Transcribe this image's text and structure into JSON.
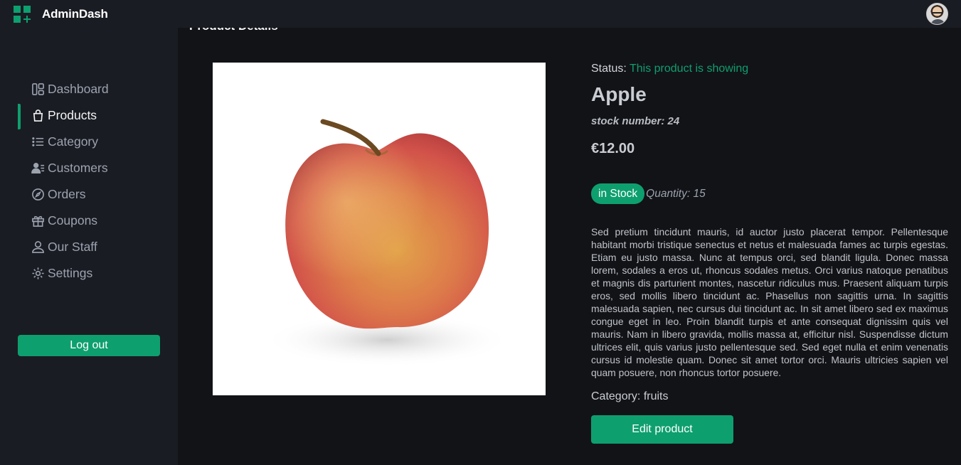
{
  "app": {
    "name": "AdminDash"
  },
  "sidebar": {
    "items": [
      {
        "label": "Dashboard",
        "icon": "grid-icon",
        "active": false
      },
      {
        "label": "Products",
        "icon": "shopping-bag-icon",
        "active": true
      },
      {
        "label": "Category",
        "icon": "list-icon",
        "active": false
      },
      {
        "label": "Customers",
        "icon": "users-icon",
        "active": false
      },
      {
        "label": "Orders",
        "icon": "compass-icon",
        "active": false
      },
      {
        "label": "Coupons",
        "icon": "gift-icon",
        "active": false
      },
      {
        "label": "Our Staff",
        "icon": "user-icon",
        "active": false
      },
      {
        "label": "Settings",
        "icon": "gear-icon",
        "active": false
      }
    ],
    "logout_label": "Log out"
  },
  "page": {
    "title": "Product Details"
  },
  "product": {
    "status_label": "Status:",
    "status_value": "This product is showing",
    "name": "Apple",
    "stock_number": "stock number: 24",
    "price": "€12.00",
    "stock_badge": "in Stock",
    "quantity": "Quantity: 15",
    "description": "Sed pretium tincidunt mauris, id auctor justo placerat tempor. Pellentesque habitant morbi tristique senectus et netus et malesuada fames ac turpis egestas. Etiam eu justo massa. Nunc at tempus orci, sed blandit ligula. Donec massa lorem, sodales a eros ut, rhoncus sodales metus. Orci varius natoque penatibus et magnis dis parturient montes, nascetur ridiculus mus. Praesent aliquam turpis eros, sed mollis libero tincidunt ac. Phasellus non sagittis urna. In sagittis malesuada sapien, nec cursus dui tincidunt ac. In sit amet libero sed ex maximus congue eget in leo. Proin blandit turpis et ante consequat dignissim quis vel mauris. Nam in libero gravida, mollis massa at, efficitur nisl. Suspendisse dictum ultrices elit, quis varius justo pellentesque sed. Sed eget nulla et enim venenatis cursus id molestie quam. Donec sit amet tortor orci. Mauris ultricies sapien vel quam posuere, non rhoncus tortor posuere.",
    "category": "Category: fruits",
    "edit_label": "Edit product"
  },
  "colors": {
    "accent": "#0e9f6e",
    "sidebar_bg": "#1a1c23",
    "main_bg": "#121317"
  }
}
